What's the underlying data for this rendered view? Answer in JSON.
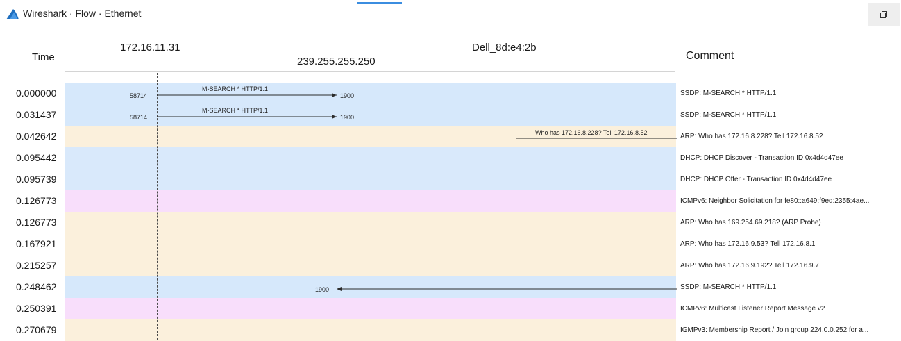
{
  "window": {
    "title": "Wireshark · Flow · Ethernet",
    "minimize_icon": "minimize-icon",
    "maximize_icon": "restore-icon"
  },
  "header": {
    "time_label": "Time",
    "comment_label": "Comment",
    "nodes": [
      {
        "label": "172.16.11.31"
      },
      {
        "label": "239.255.255.250"
      },
      {
        "label": "Dell_8d:e4:2b"
      }
    ]
  },
  "colors": {
    "ssdp": "#d6e8fb",
    "arp": "#fbf0dc",
    "dhcp": "#d9e9fb",
    "icmpv6": "#f8defb",
    "igmp": "#fbf0dc",
    "accent": "#3b8de0"
  },
  "rows": [
    {
      "time": "0.000000",
      "comment": "SSDP: M-SEARCH * HTTP/1.1",
      "color": "#d6e8fb",
      "arrow": {
        "label": "M-SEARCH * HTTP/1.1",
        "src_port": "58714",
        "dst_port": "1900"
      }
    },
    {
      "time": "0.031437",
      "comment": "SSDP: M-SEARCH * HTTP/1.1",
      "color": "#d6e8fb",
      "arrow": {
        "label": "M-SEARCH * HTTP/1.1",
        "src_port": "58714",
        "dst_port": "1900"
      }
    },
    {
      "time": "0.042642",
      "comment": "ARP: Who has 172.16.8.228? Tell 172.16.8.52",
      "color": "#fbf0dc",
      "arrow": {
        "label": "Who has 172.16.8.228? Tell 172.16.8.52"
      }
    },
    {
      "time": "0.095442",
      "comment": "DHCP: DHCP Discover - Transaction ID 0x4d4d47ee",
      "color": "#d9e9fb"
    },
    {
      "time": "0.095739",
      "comment": "DHCP: DHCP Offer    - Transaction ID 0x4d4d47ee",
      "color": "#d9e9fb"
    },
    {
      "time": "0.126773",
      "comment": "ICMPv6: Neighbor Solicitation for fe80::a649:f9ed:2355:4ae...",
      "color": "#f8defb"
    },
    {
      "time": "0.126773",
      "comment": "ARP: Who has 169.254.69.218? (ARP Probe)",
      "color": "#fbf0dc"
    },
    {
      "time": "0.167921",
      "comment": "ARP: Who has 172.16.9.53? Tell 172.16.8.1",
      "color": "#fbf0dc"
    },
    {
      "time": "0.215257",
      "comment": "ARP: Who has 172.16.9.192? Tell 172.16.9.7",
      "color": "#fbf0dc"
    },
    {
      "time": "0.248462",
      "comment": "SSDP: M-SEARCH * HTTP/1.1",
      "color": "#d6e8fb",
      "arrow": {
        "dst_port": "1900"
      }
    },
    {
      "time": "0.250391",
      "comment": "ICMPv6: Multicast Listener Report Message v2",
      "color": "#f8defb"
    },
    {
      "time": "0.270679",
      "comment": "IGMPv3: Membership Report / Join group 224.0.0.252 for a...",
      "color": "#fbf0dc"
    }
  ]
}
